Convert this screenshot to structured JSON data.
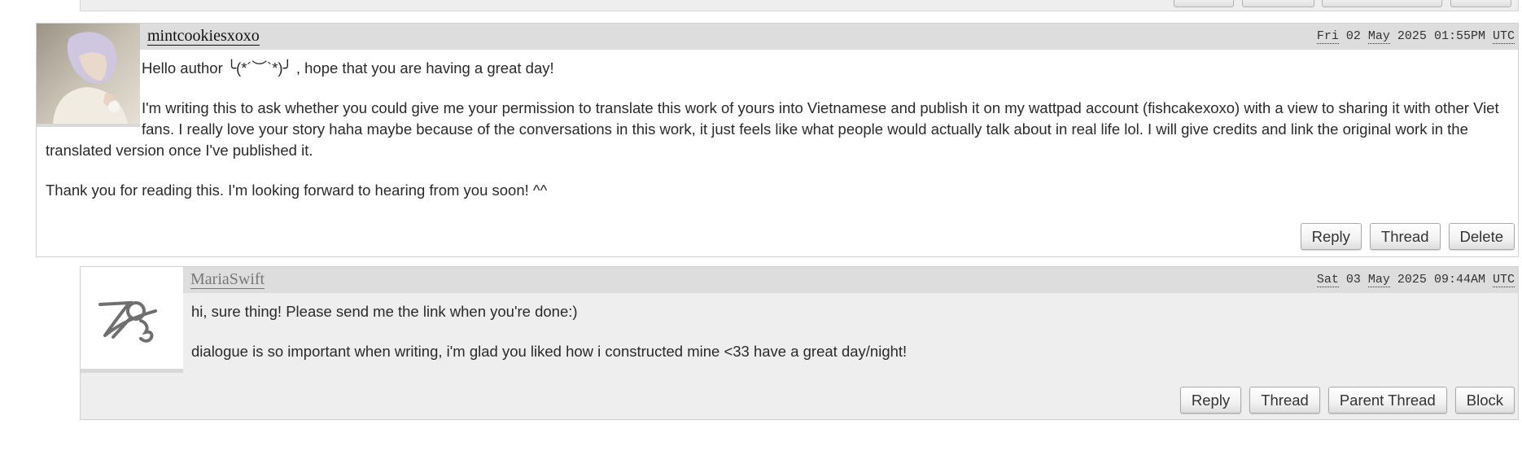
{
  "comments": [
    {
      "username": "mintcookiesxoxo",
      "day": "Fri",
      "date_num": "02",
      "month": "May",
      "year": "2025",
      "time": "01:55PM",
      "tz": "UTC",
      "paragraphs": [
        "Hello author ╰(*´︶`*)╯ , hope that you are having a great day!",
        "I'm writing this to ask whether you could give me your permission to translate this work of yours into Vietnamese and publish it on my wattpad account (fishcakexoxo) with a view to sharing it with other Viet fans. I really love your story haha maybe because of the conversations in this work, it just feels like what people would actually talk about in real life lol. I will give credits and link the original work in the translated version once I've published it.",
        "Thank you for reading this. I'm looking forward to hearing from you soon! ^^"
      ],
      "actions": {
        "reply": "Reply",
        "thread": "Thread",
        "delete": "Delete"
      }
    },
    {
      "username": "MariaSwift",
      "day": "Sat",
      "date_num": "03",
      "month": "May",
      "year": "2025",
      "time": "09:44AM",
      "tz": "UTC",
      "paragraphs": [
        "hi, sure thing! Please send me the link when you're done:)",
        "dialogue is so important when writing, i'm glad you liked how i constructed mine <33 have a great day/night!"
      ],
      "actions": {
        "reply": "Reply",
        "thread": "Thread",
        "parent_thread": "Parent Thread",
        "block": "Block"
      }
    }
  ],
  "icons": {
    "avatar_1": "user-avatar-photo",
    "avatar_2": "default-avatar-icon"
  },
  "colors": {
    "header_bar": "#dddddd",
    "reply_bg": "#eeeeee"
  }
}
